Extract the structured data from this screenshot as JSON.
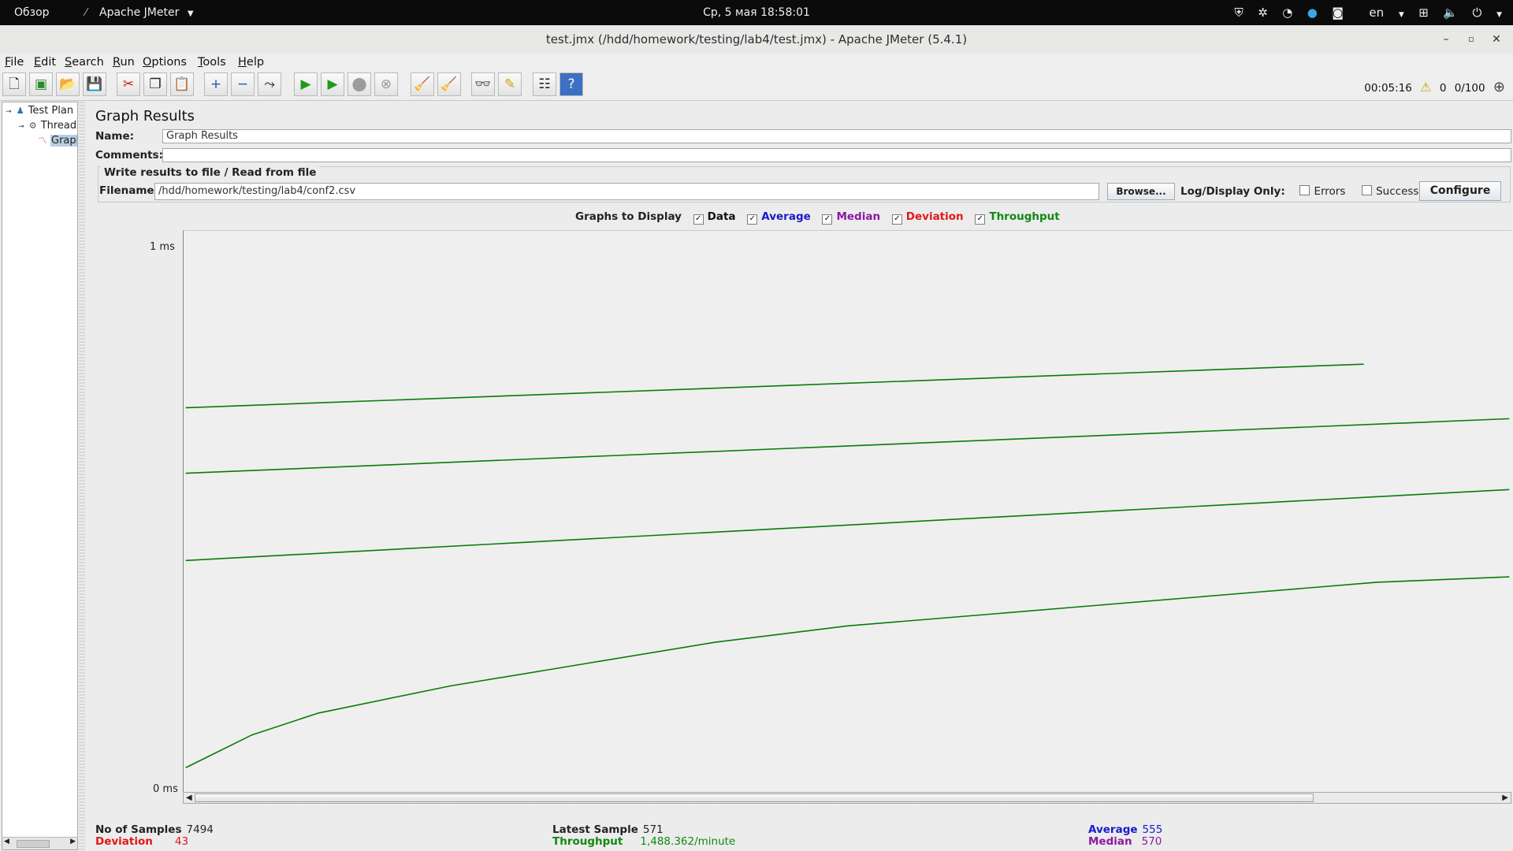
{
  "topbar": {
    "activities": "Обзор",
    "app_name": "Apache JMeter",
    "clock": "Ср, 5 мая  18:58:01",
    "lang": "en"
  },
  "window": {
    "title": "test.jmx (/hdd/homework/testing/lab4/test.jmx) - Apache JMeter (5.4.1)"
  },
  "menu": [
    "File",
    "Edit",
    "Search",
    "Run",
    "Options",
    "Tools",
    "Help"
  ],
  "status": {
    "elapsed": "00:05:16",
    "errors": "0",
    "threads": "0/100"
  },
  "tree": {
    "items": [
      "Test Plan",
      "Thread Group",
      "Graph Results"
    ]
  },
  "panel": {
    "title": "Graph Results",
    "name_label": "Name:",
    "name_value": "Graph Results",
    "comments_label": "Comments:",
    "comments_value": "",
    "file_legend": "Write results to file / Read from file",
    "filename_label": "Filename",
    "filename_value": "/hdd/homework/testing/lab4/conf2.csv",
    "browse_label": "Browse...",
    "log_display_label": "Log/Display Only:",
    "errors_label": "Errors",
    "successes_label": "Successes",
    "configure_label": "Configure",
    "graphs_label": "Graphs to Display",
    "graph_options": [
      {
        "label": "Data",
        "color": "#111111",
        "checked": true
      },
      {
        "label": "Average",
        "color": "#1a1acc",
        "checked": true
      },
      {
        "label": "Median",
        "color": "#8b1a9e",
        "checked": true
      },
      {
        "label": "Deviation",
        "color": "#e01818",
        "checked": true
      },
      {
        "label": "Throughput",
        "color": "#118811",
        "checked": true
      }
    ]
  },
  "chart_data": {
    "type": "line",
    "ylabel_top": "1  ms",
    "ylabel_bottom": "0  ms",
    "series_color": "#0a7a0a",
    "x_range": [
      0,
      1
    ],
    "y_range": [
      0,
      1
    ],
    "series": [
      {
        "x": [
          0,
          0.89
        ],
        "y": [
          0.69,
          0.77
        ]
      },
      {
        "x": [
          0,
          1.0
        ],
        "y": [
          0.57,
          0.67
        ]
      },
      {
        "x": [
          0,
          1.0
        ],
        "y": [
          0.41,
          0.54
        ]
      },
      {
        "x": [
          0,
          0.05,
          0.1,
          0.2,
          0.3,
          0.4,
          0.5,
          0.6,
          0.7,
          0.8,
          0.9,
          1.0
        ],
        "y": [
          0.03,
          0.09,
          0.13,
          0.18,
          0.22,
          0.26,
          0.29,
          0.31,
          0.33,
          0.35,
          0.37,
          0.38
        ]
      }
    ]
  },
  "stats": {
    "samples_label": "No of Samples",
    "samples_value": "7494",
    "deviation_label": "Deviation",
    "deviation_value": "43",
    "latest_label": "Latest Sample",
    "latest_value": "571",
    "throughput_label": "Throughput",
    "throughput_value": "1,488.362/minute",
    "average_label": "Average",
    "average_value": "555",
    "median_label": "Median",
    "median_value": "570"
  }
}
